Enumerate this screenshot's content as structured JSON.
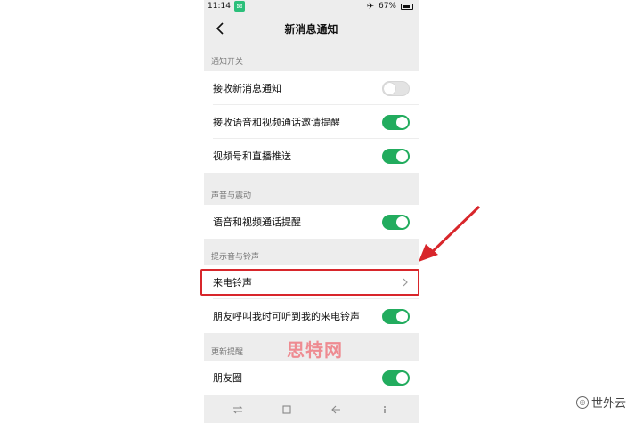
{
  "status_bar": {
    "time": "11:14",
    "battery": "67%",
    "icons": [
      "app-notification-icon",
      "airplane-icon",
      "battery-icon"
    ]
  },
  "header": {
    "title": "新消息通知",
    "back_icon": "chevron-left-icon"
  },
  "sections": [
    {
      "header": "通知开关",
      "rows": [
        {
          "label": "接收新消息通知",
          "toggle": false
        },
        {
          "label": "接收语音和视频通话邀请提醒",
          "toggle": true
        },
        {
          "label": "视频号和直播推送",
          "toggle": true
        }
      ]
    },
    {
      "header": "声音与震动",
      "rows": [
        {
          "label": "语音和视频通话提醒",
          "toggle": true
        }
      ]
    },
    {
      "header": "提示音与铃声",
      "rows": [
        {
          "label": "来电铃声",
          "chevron": true
        },
        {
          "label": "朋友呼叫我时可听到我的来电铃声",
          "toggle": true
        }
      ]
    },
    {
      "header": "更新提醒",
      "rows": [
        {
          "label": "朋友圈",
          "toggle": true
        }
      ]
    }
  ],
  "bottom_nav": {
    "icons": [
      "menu-swap-icon",
      "home-square-icon",
      "back-arrow-icon",
      "overflow-dots-icon"
    ]
  },
  "annotation": {
    "highlight_color": "#d8262b",
    "arrow_color": "#d8262b"
  },
  "watermarks": {
    "center": "思特网",
    "corner": "世外云"
  },
  "colors": {
    "toggle_on": "#22ac5e",
    "toggle_off": "#e3e3e3",
    "background": "#ededed"
  }
}
